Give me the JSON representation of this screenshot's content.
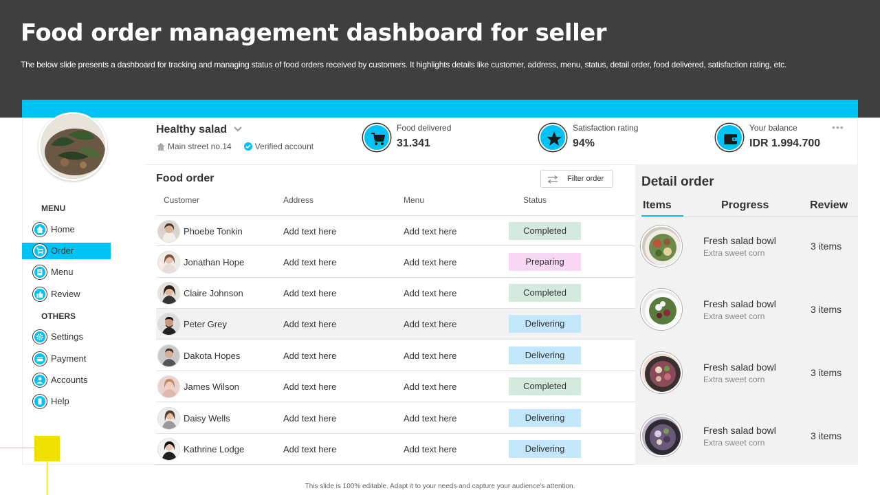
{
  "header": {
    "title": "Food order management dashboard for seller",
    "subtitle": "The below slide presents a dashboard for tracking and managing status of food orders received by customers. It highlights details like customer, address, menu, status, detail order, food delivered, satisfaction rating, etc."
  },
  "shop": {
    "name": "Healthy salad",
    "address": "Main street no.14",
    "verified": "Verified account"
  },
  "stats": [
    {
      "label": "Food delivered",
      "value": "31.341",
      "icon": "cart-icon"
    },
    {
      "label": "Satisfaction rating",
      "value": "94%",
      "icon": "star-icon"
    },
    {
      "label": "Your balance",
      "value": "IDR 1.994.700",
      "icon": "wallet-icon"
    }
  ],
  "sidebar": {
    "menu_heading": "MENU",
    "others_heading": "OTHERS",
    "menu_items": [
      {
        "label": "Home",
        "icon": "home-icon"
      },
      {
        "label": "Order",
        "icon": "cart-icon"
      },
      {
        "label": "Menu",
        "icon": "book-icon"
      },
      {
        "label": "Review",
        "icon": "thumbs-up-icon"
      }
    ],
    "other_items": [
      {
        "label": "Settings",
        "icon": "gear-icon"
      },
      {
        "label": "Payment",
        "icon": "card-icon"
      },
      {
        "label": "Accounts",
        "icon": "user-icon"
      },
      {
        "label": "Help",
        "icon": "phone-icon"
      }
    ]
  },
  "orders": {
    "title": "Food order",
    "filter_label": "Filter order",
    "columns": [
      "Customer",
      "Address",
      "Menu",
      "Status"
    ],
    "rows": [
      {
        "customer": "Phoebe Tonkin",
        "address": "Add text here",
        "menu": "Add text here",
        "status": "Completed"
      },
      {
        "customer": "Jonathan Hope",
        "address": "Add text here",
        "menu": "Add text here",
        "status": "Preparing"
      },
      {
        "customer": "Claire Johnson",
        "address": "Add text here",
        "menu": "Add text here",
        "status": "Completed"
      },
      {
        "customer": "Peter Grey",
        "address": "Add text here",
        "menu": "Add text here",
        "status": "Delivering"
      },
      {
        "customer": "Dakota Hopes",
        "address": "Add text here",
        "menu": "Add text here",
        "status": "Delivering"
      },
      {
        "customer": "James Wilson",
        "address": "Add text here",
        "menu": "Add text here",
        "status": "Completed"
      },
      {
        "customer": "Daisy Wells",
        "address": "Add text here",
        "menu": "Add text here",
        "status": "Delivering"
      },
      {
        "customer": "Kathrine Lodge",
        "address": "Add text here",
        "menu": "Add text here",
        "status": "Delivering"
      }
    ]
  },
  "detail": {
    "title": "Detail order",
    "tabs": [
      "Items",
      "Progress",
      "Review"
    ],
    "items": [
      {
        "name": "Fresh salad bowl",
        "sub": "Extra sweet corn",
        "count": "3 items"
      },
      {
        "name": "Fresh salad bowl",
        "sub": "Extra sweet corn",
        "count": "3 items"
      },
      {
        "name": "Fresh salad bowl",
        "sub": "Extra sweet corn",
        "count": "3 items"
      },
      {
        "name": "Fresh salad bowl",
        "sub": "Extra sweet corn",
        "count": "3 items"
      }
    ]
  },
  "colors": {
    "accent": "#00c2f5",
    "header_bg": "#3f3f3f",
    "completed": "#d4eadf",
    "preparing": "#f7d7f3",
    "delivering": "#c3e6fa",
    "decor": "#f0e000"
  },
  "footer": "This slide is 100% editable. Adapt it to your needs and capture your audience's attention."
}
